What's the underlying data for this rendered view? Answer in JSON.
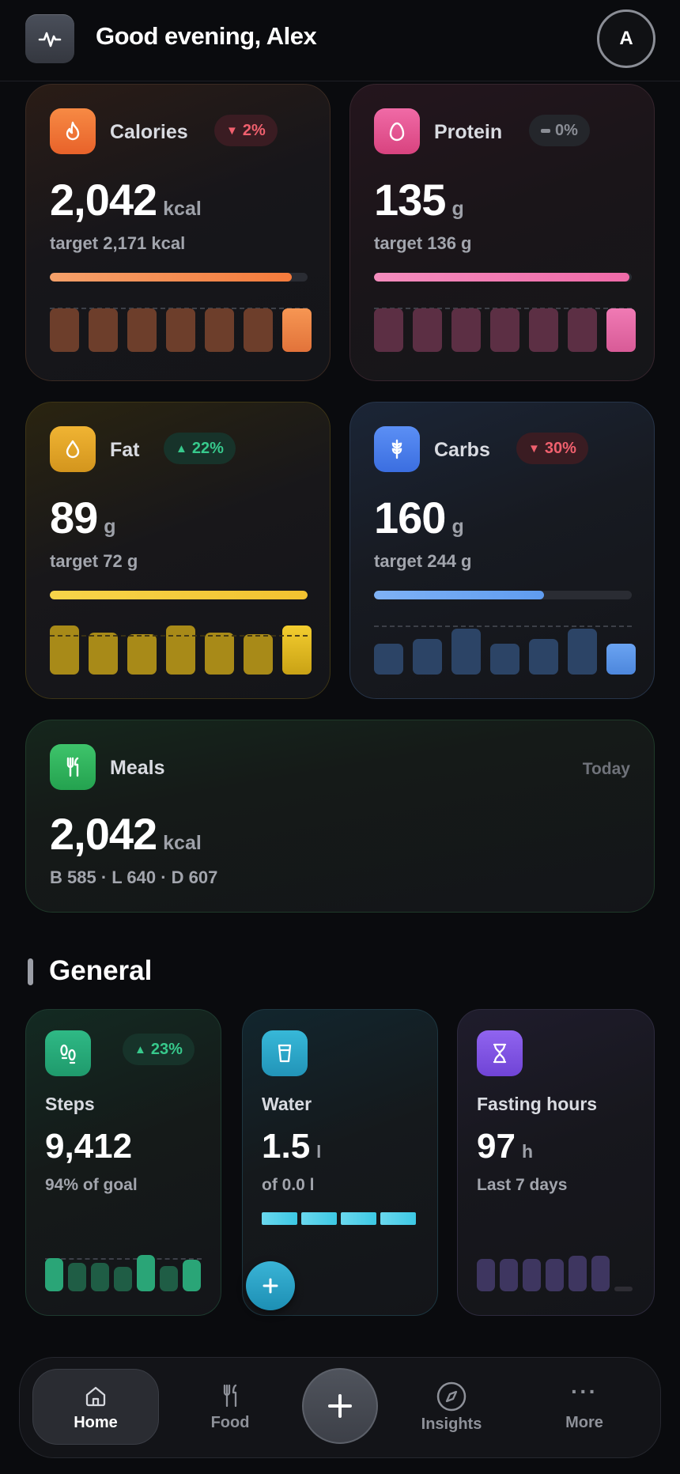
{
  "header": {
    "greeting": "Good evening, Alex",
    "avatar_initial": "A"
  },
  "nutrition": {
    "calories": {
      "title": "Calories",
      "badge": "2%",
      "badge_direction": "down",
      "value": "2,042",
      "unit": "kcal",
      "target": "target 2,171 kcal",
      "progress": 0.94,
      "bars": [
        0.95,
        0.95,
        0.95,
        0.95,
        0.95,
        0.95,
        0.95
      ],
      "color": "#f78a44"
    },
    "protein": {
      "title": "Protein",
      "badge": "0%",
      "badge_direction": "flat",
      "value": "135",
      "unit": "g",
      "target": "target 136 g",
      "progress": 0.99,
      "bars": [
        0.95,
        0.95,
        0.95,
        0.95,
        0.95,
        0.95,
        0.95
      ],
      "color": "#f06aa6"
    },
    "fat": {
      "title": "Fat",
      "badge": "22%",
      "badge_direction": "up",
      "value": "89",
      "unit": "g",
      "target": "target 72 g",
      "progress": 1.0,
      "bars": [
        1.0,
        0.85,
        0.82,
        1.0,
        0.85,
        0.82,
        1.0
      ],
      "color": "#f0c532"
    },
    "carbs": {
      "title": "Carbs",
      "badge": "30%",
      "badge_direction": "down",
      "value": "160",
      "unit": "g",
      "target": "target 244 g",
      "progress": 0.66,
      "bars": [
        0.68,
        0.78,
        1.0,
        0.68,
        0.78,
        1.0,
        0.68
      ],
      "color": "#5f9cf0"
    }
  },
  "meals": {
    "title": "Meals",
    "period": "Today",
    "value": "2,042",
    "unit": "kcal",
    "breakdown": "B 585 · L 640 · D 607"
  },
  "general": {
    "section_title": "General",
    "steps": {
      "title": "Steps",
      "badge": "23%",
      "badge_direction": "up",
      "value": "9,412",
      "goal": "94% of goal",
      "bars": [
        0.92,
        0.78,
        0.78,
        0.68,
        1.0,
        0.7,
        0.88
      ]
    },
    "water": {
      "title": "Water",
      "value": "1.5",
      "unit": "l",
      "goal": "of 0.0 l",
      "segments": 4
    },
    "fasting": {
      "title": "Fasting hours",
      "value": "97",
      "unit": "h",
      "period": "Last 7 days",
      "bars": [
        0.9,
        0.9,
        0.9,
        0.9,
        0.97,
        0.97,
        0.12
      ]
    }
  },
  "nav": {
    "home": "Home",
    "food": "Food",
    "insights": "Insights",
    "more": "More"
  }
}
